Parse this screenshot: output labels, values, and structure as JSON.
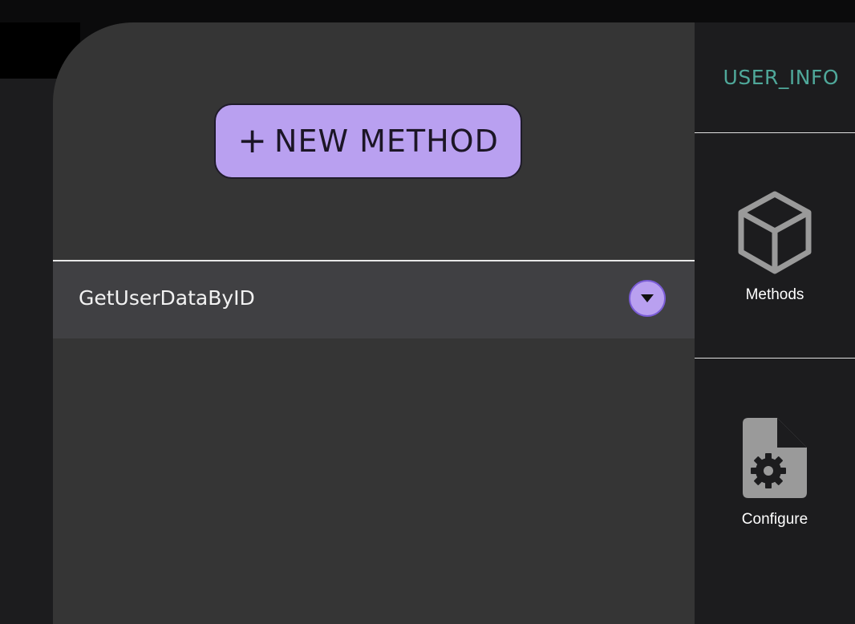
{
  "toolbar": {
    "new_method_label": "NEW METHOD",
    "new_method_icon": "plus-icon"
  },
  "methods": {
    "items": [
      {
        "name": "GetUserDataByID",
        "expand_icon": "chevron-down-icon"
      }
    ]
  },
  "sidebar": {
    "title": "USER_INFO",
    "title_color": "#4fa89a",
    "items": [
      {
        "label": "Methods",
        "icon": "cube-icon"
      },
      {
        "label": "Configure",
        "icon": "file-gear-icon"
      }
    ]
  },
  "colors": {
    "accent": "#b9a0f0",
    "panel": "#353535",
    "sidebar": "#1c1c1e"
  }
}
